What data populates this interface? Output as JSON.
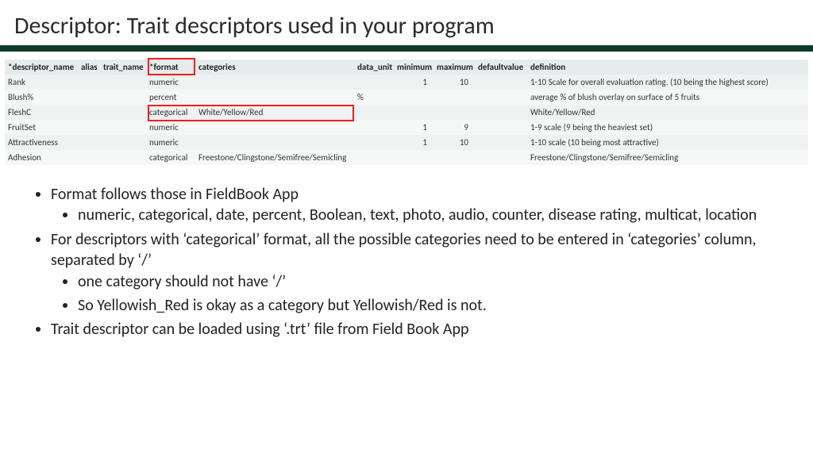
{
  "title": "Descriptor: Trait descriptors used in your program",
  "columns": {
    "descriptor_name": "*descriptor_name",
    "alias": "alias",
    "trait_name": "trait_name",
    "format": "*format",
    "categories": "categories",
    "data_unit": "data_unit",
    "minimum": "minimum",
    "maximum": "maximum",
    "defaultvalue": "defaultvalue",
    "definition": "definition"
  },
  "rows": [
    {
      "descriptor_name": "Rank",
      "alias": "",
      "trait_name": "",
      "format": "numeric",
      "categories": "",
      "data_unit": "",
      "minimum": "1",
      "maximum": "10",
      "defaultvalue": "",
      "definition": "1-10 Scale for overall evaluation rating. (10 being the highest score)"
    },
    {
      "descriptor_name": "Blush%",
      "alias": "",
      "trait_name": "",
      "format": "percent",
      "categories": "",
      "data_unit": "%",
      "minimum": "",
      "maximum": "",
      "defaultvalue": "",
      "definition": "average % of blush overlay on surface of 5 fruits"
    },
    {
      "descriptor_name": "FleshC",
      "alias": "",
      "trait_name": "",
      "format": "categorical",
      "categories": "White/Yellow/Red",
      "data_unit": "",
      "minimum": "",
      "maximum": "",
      "defaultvalue": "",
      "definition": "White/Yellow/Red"
    },
    {
      "descriptor_name": "FruitSet",
      "alias": "",
      "trait_name": "",
      "format": "numeric",
      "categories": "",
      "data_unit": "",
      "minimum": "1",
      "maximum": "9",
      "defaultvalue": "",
      "definition": "1-9 scale (9 being the heaviest set)"
    },
    {
      "descriptor_name": "Attractiveness",
      "alias": "",
      "trait_name": "",
      "format": "numeric",
      "categories": "",
      "data_unit": "",
      "minimum": "1",
      "maximum": "10",
      "defaultvalue": "",
      "definition": "1-10 scale (10 being most attractive)"
    },
    {
      "descriptor_name": "Adhesion",
      "alias": "",
      "trait_name": "",
      "format": "categorical",
      "categories": "Freestone/Clingstone/Semifree/Semicling",
      "data_unit": "",
      "minimum": "",
      "maximum": "",
      "defaultvalue": "",
      "definition": "Freestone/Clingstone/Semifree/Semicling"
    }
  ],
  "bullets": {
    "b1": "Format follows those in FieldBook App",
    "b1a": "numeric, categorical, date, percent, Boolean, text, photo, audio, counter, disease rating, multicat, location",
    "b2": "For descriptors with ‘categorical’ format, all the possible categories need to be entered in ‘categories’ column, separated by ‘/’",
    "b2a": "one category should not have ‘/’",
    "b2b": "So Yellowish_Red is okay as a category but Yellowish/Red is not.",
    "b3": "Trait descriptor can be loaded using ‘.trt’ file from Field Book App"
  }
}
